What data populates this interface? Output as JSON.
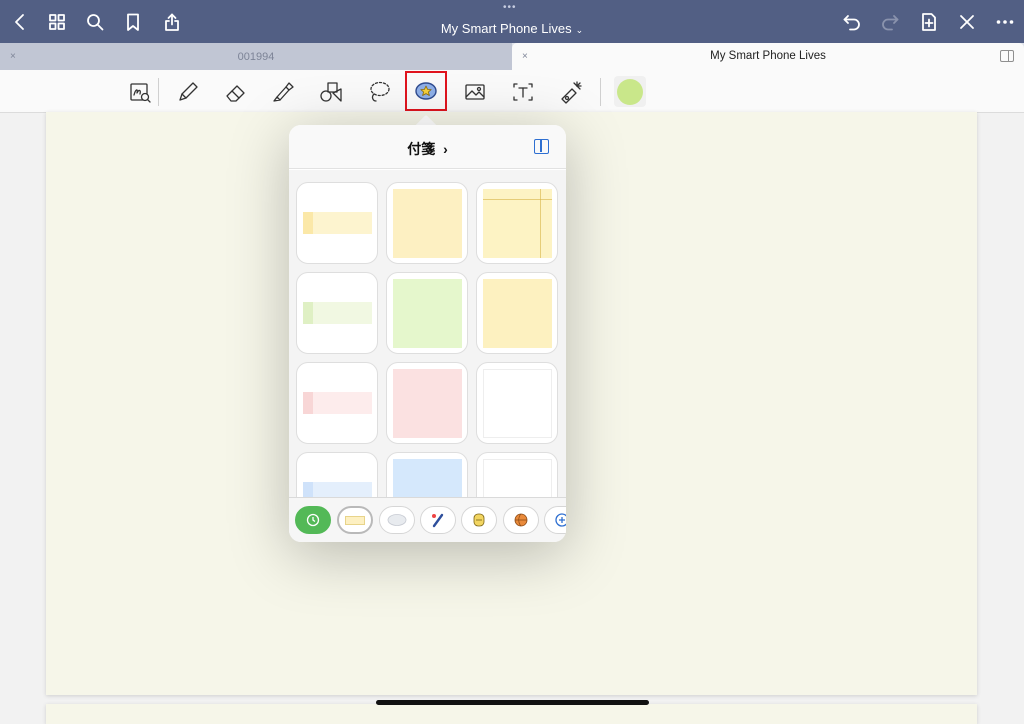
{
  "top_bar": {
    "title": "My Smart Phone Lives",
    "title_chevron": "⌄",
    "more_handle": "•••"
  },
  "tabs": [
    {
      "label": "001994",
      "active": false
    },
    {
      "label": "My Smart Phone Lives",
      "active": true
    }
  ],
  "tab_close_glyph": "×",
  "toolbar": {
    "tools": [
      "zoom-window",
      "pen",
      "eraser",
      "highlighter",
      "shapes",
      "lasso",
      "elements",
      "image",
      "text",
      "laser-pointer"
    ],
    "selected_tool": "elements",
    "current_color": "#c9e78a"
  },
  "popover": {
    "title": "付箋",
    "title_chevron": "›",
    "stickers": [
      {
        "kind": "flag",
        "color": "#fdf4cf",
        "tab_color": "#fbe8a8"
      },
      {
        "kind": "square",
        "color": "#fdf0c2"
      },
      {
        "kind": "square-ruled",
        "color": "#fdf3c4"
      },
      {
        "kind": "flag",
        "color": "#f1f8e2",
        "tab_color": "#dff0c4"
      },
      {
        "kind": "square",
        "color": "#e5f7cc"
      },
      {
        "kind": "lined",
        "color": "#fdf1c0"
      },
      {
        "kind": "flag",
        "color": "#fdecec",
        "tab_color": "#f8d6d6"
      },
      {
        "kind": "square",
        "color": "#fbe1e1"
      },
      {
        "kind": "grid",
        "color": "#ffffff"
      },
      {
        "kind": "flag",
        "color": "#e4effc",
        "tab_color": "#cfe2fa"
      },
      {
        "kind": "square",
        "color": "#d5e8fc"
      },
      {
        "kind": "grid-lined",
        "color": "#ffffff"
      }
    ],
    "categories": [
      "recent",
      "sticky-notes",
      "speech-bubbles",
      "stationery",
      "food",
      "sports",
      "add"
    ],
    "active_category": "sticky-notes"
  }
}
